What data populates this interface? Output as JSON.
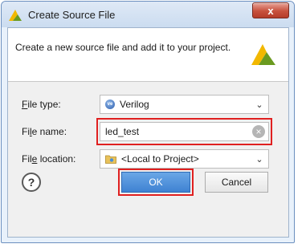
{
  "window": {
    "title": "Create Source File",
    "close_glyph": "x"
  },
  "header": {
    "description": "Create a new source file and add it to your project."
  },
  "form": {
    "file_type": {
      "label_pre": "",
      "label_key": "F",
      "label_post": "ile type:",
      "value": "Verilog",
      "icon": "verilog-icon",
      "icon_text": "ve"
    },
    "file_name": {
      "label_pre": "Fi",
      "label_key": "l",
      "label_post": "e name:",
      "value": "led_test"
    },
    "file_location": {
      "label_pre": "Fil",
      "label_key": "e",
      "label_post": " location:",
      "value": "<Local to Project>",
      "icon": "folder-icon"
    }
  },
  "buttons": {
    "help": "?",
    "ok": "OK",
    "cancel": "Cancel"
  },
  "colors": {
    "highlight": "#e02020",
    "ok_button": "#3f82d2",
    "logo_green": "#6a9a1f",
    "logo_yellow": "#f2b800"
  }
}
